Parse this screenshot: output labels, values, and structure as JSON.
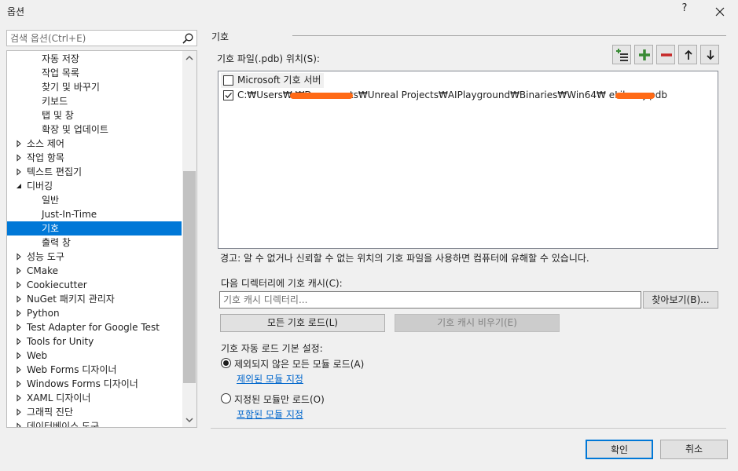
{
  "window": {
    "title": "옵션",
    "help": "?",
    "close_icon": "close-icon"
  },
  "search": {
    "placeholder": "검색 옵션(Ctrl+E)"
  },
  "tree": {
    "items": [
      {
        "label": "자동 저장",
        "level": 2,
        "arrow": ""
      },
      {
        "label": "작업 목록",
        "level": 2,
        "arrow": ""
      },
      {
        "label": "찾기 및 바꾸기",
        "level": 2,
        "arrow": ""
      },
      {
        "label": "키보드",
        "level": 2,
        "arrow": ""
      },
      {
        "label": "탭 및 창",
        "level": 2,
        "arrow": ""
      },
      {
        "label": "확장 및 업데이트",
        "level": 2,
        "arrow": ""
      },
      {
        "label": "소스 제어",
        "level": 1,
        "arrow": "collapsed"
      },
      {
        "label": "작업 항목",
        "level": 1,
        "arrow": "collapsed"
      },
      {
        "label": "텍스트 편집기",
        "level": 1,
        "arrow": "collapsed"
      },
      {
        "label": "디버깅",
        "level": 1,
        "arrow": "expanded"
      },
      {
        "label": "일반",
        "level": 2,
        "arrow": ""
      },
      {
        "label": "Just-In-Time",
        "level": 2,
        "arrow": ""
      },
      {
        "label": "기호",
        "level": 2,
        "arrow": "",
        "selected": true
      },
      {
        "label": "출력 창",
        "level": 2,
        "arrow": ""
      },
      {
        "label": "성능 도구",
        "level": 1,
        "arrow": "collapsed"
      },
      {
        "label": "CMake",
        "level": 1,
        "arrow": "collapsed"
      },
      {
        "label": "Cookiecutter",
        "level": 1,
        "arrow": "collapsed"
      },
      {
        "label": "NuGet 패키지 관리자",
        "level": 1,
        "arrow": "collapsed"
      },
      {
        "label": "Python",
        "level": 1,
        "arrow": "collapsed"
      },
      {
        "label": "Test Adapter for Google Test",
        "level": 1,
        "arrow": "collapsed"
      },
      {
        "label": "Tools for Unity",
        "level": 1,
        "arrow": "collapsed"
      },
      {
        "label": "Web",
        "level": 1,
        "arrow": "collapsed"
      },
      {
        "label": "Web Forms 디자이너",
        "level": 1,
        "arrow": "collapsed"
      },
      {
        "label": "Windows Forms 디자이너",
        "level": 1,
        "arrow": "collapsed"
      },
      {
        "label": "XAML 디자이너",
        "level": 1,
        "arrow": "collapsed"
      },
      {
        "label": "그래픽 진단",
        "level": 1,
        "arrow": "collapsed"
      },
      {
        "label": "데이터베이스 도구",
        "level": 1,
        "arrow": "collapsed"
      }
    ]
  },
  "section": {
    "title": "기호"
  },
  "locations": {
    "label": "기호 파일(.pdb) 위치(S):",
    "toolbar": [
      "add-folder-icon",
      "plus-icon",
      "minus-icon",
      "arrow-up-icon",
      "arrow-down-icon"
    ],
    "rows": [
      {
        "checked": false,
        "text": "Microsoft 기호 서버"
      },
      {
        "checked": true,
        "text": "C:₩Users₩                  ₩Documents₩Unreal Projects₩AIPlayground₩Binaries₩Win64₩                eLibrary.pdb"
      }
    ]
  },
  "warning": "경고: 알 수 없거나 신뢰할 수 없는 위치의 기호 파일을 사용하면 컴퓨터에 유해할 수 있습니다.",
  "cache": {
    "label": "다음 디렉터리에 기호 캐시(C):",
    "placeholder": "기호 캐시 디렉터리...",
    "browse": "찾아보기(B)..."
  },
  "buttons": {
    "load_all": "모든 기호 로드(L)",
    "empty_cache": "기호 캐시 비우기(E)"
  },
  "autoload": {
    "label": "기호 자동 로드 기본 설정:",
    "option1": "제외되지 않은 모든 모듈 로드(A)",
    "link1": "제외된 모듈 지정",
    "option2": "지정된 모듈만 로드(O)",
    "link2": "포함된 모듈 지정",
    "selected": "option1"
  },
  "dialog": {
    "ok": "확인",
    "cancel": "취소"
  },
  "colors": {
    "accent": "#0078d7",
    "redaction": "#ff6a16",
    "link": "#0066cc"
  }
}
